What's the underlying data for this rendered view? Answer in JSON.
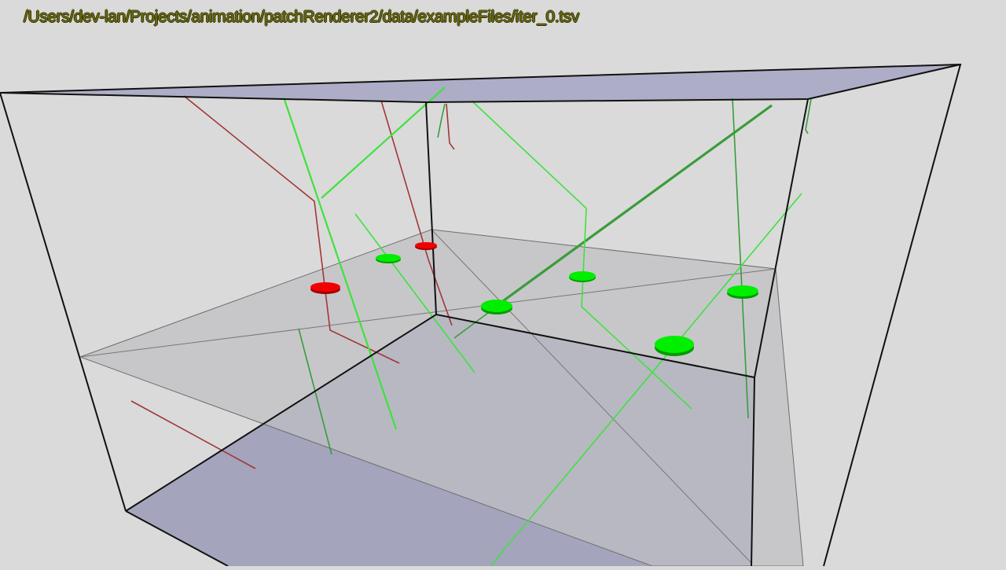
{
  "viewer": {
    "file_path": "/Users/dev-lan/Projects/animation/patchRenderer2/data/exampleFiles/iter_0.tsv"
  },
  "colors": {
    "background": "#dadada",
    "box_edge": "#000000",
    "floor_fill": "#9d9db6",
    "ceiling_fill": "#b0b0c9",
    "plane_fill": "#c4c4c8",
    "active_patch": "#00e600",
    "inactive_patch": "#e60000",
    "active_track": "#2fdc2f",
    "dim_track": "#2e9a2e",
    "inactive_track": "#9c3232"
  }
}
